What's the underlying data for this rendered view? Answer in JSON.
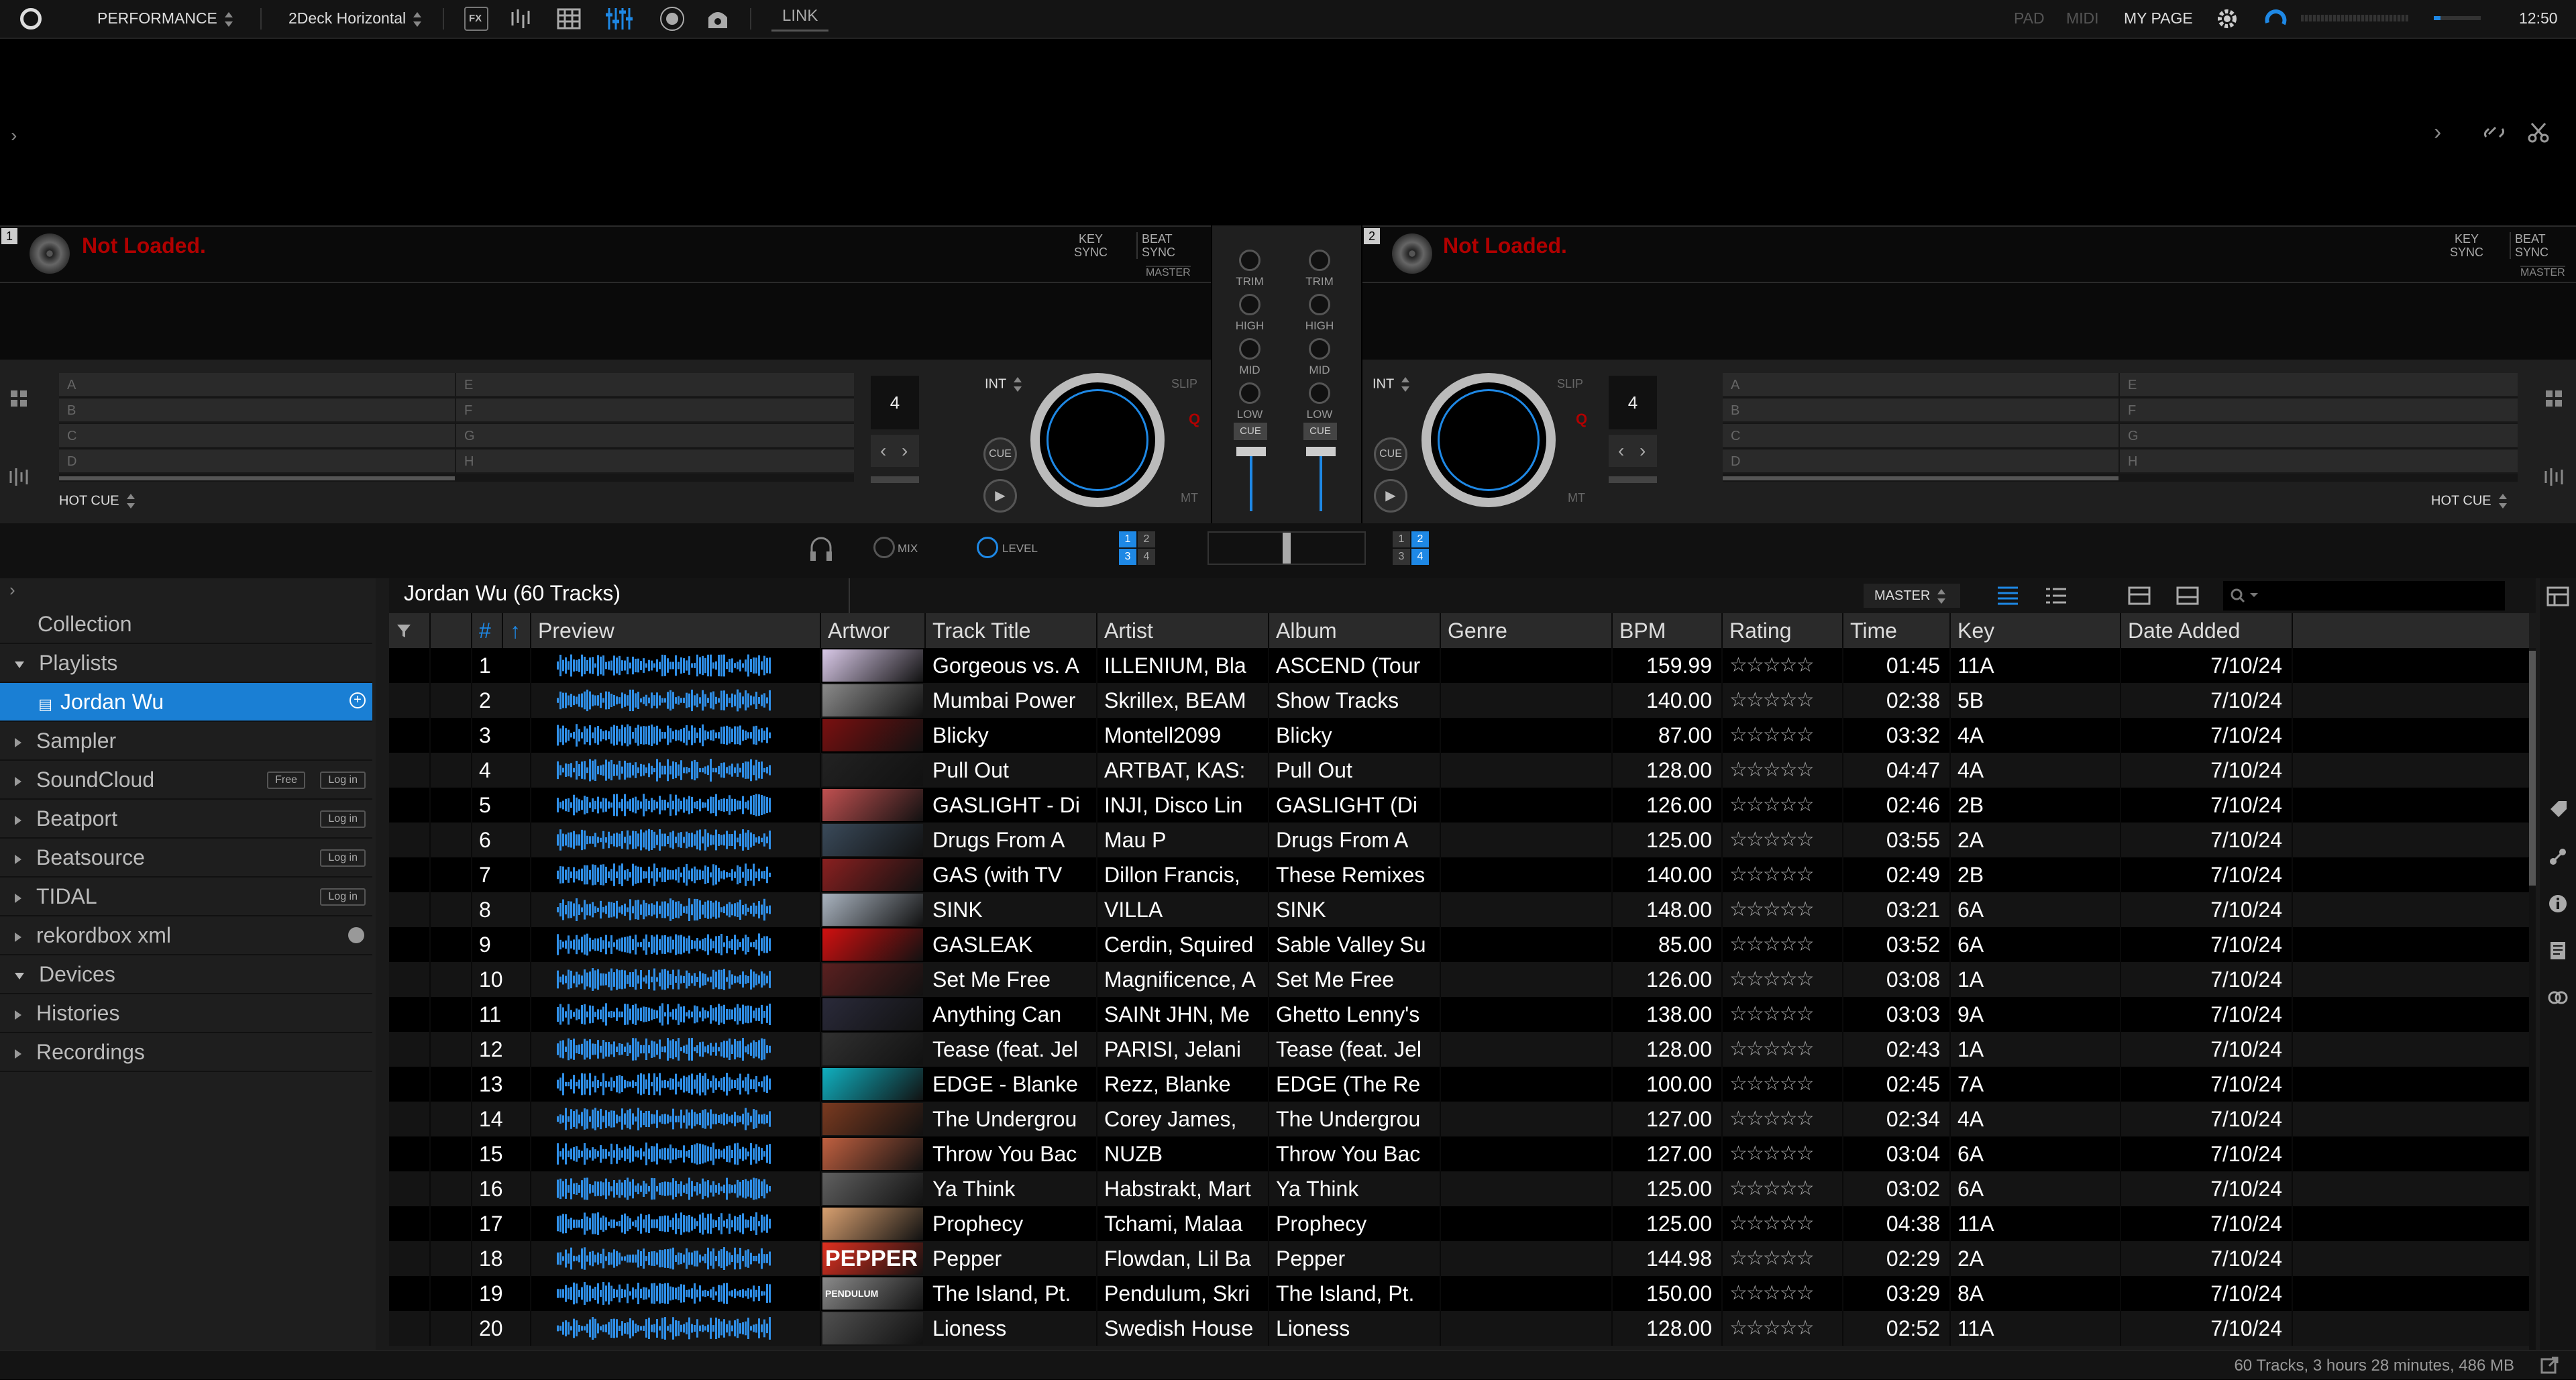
{
  "topbar": {
    "mode": "PERFORMANCE",
    "layout": "2Deck Horizontal",
    "fx": "FX",
    "link": "LINK",
    "pad": "PAD",
    "midi": "MIDI",
    "mypage": "MY PAGE",
    "time": "12:50"
  },
  "decks": [
    {
      "number": "1",
      "status": "Not Loaded.",
      "key_sync": [
        "KEY",
        "SYNC"
      ],
      "beat_sync": [
        "BEAT",
        "SYNC"
      ],
      "master": "MASTER",
      "hotcues": [
        "A",
        "B",
        "C",
        "D",
        "E",
        "F",
        "G",
        "H"
      ],
      "hotcue_label": "HOT CUE",
      "beat_count": "4",
      "int": "INT",
      "slip": "SLIP",
      "q": "Q",
      "mt": "MT",
      "cue": "CUE"
    },
    {
      "number": "2",
      "status": "Not Loaded.",
      "key_sync": [
        "KEY",
        "SYNC"
      ],
      "beat_sync": [
        "BEAT",
        "SYNC"
      ],
      "master": "MASTER",
      "hotcues": [
        "A",
        "B",
        "C",
        "D",
        "E",
        "F",
        "G",
        "H"
      ],
      "hotcue_label": "HOT CUE",
      "beat_count": "4",
      "int": "INT",
      "slip": "SLIP",
      "q": "Q",
      "mt": "MT",
      "cue": "CUE"
    }
  ],
  "mixer": {
    "labels": [
      "TRIM",
      "HIGH",
      "MID",
      "LOW"
    ],
    "cue": "CUE",
    "mix": "MIX",
    "level": "LEVEL",
    "fx_assign_left": [
      "1",
      "2",
      "3",
      "4"
    ],
    "fx_assign_right": [
      "1",
      "2",
      "3",
      "4"
    ]
  },
  "sidebar": {
    "items": [
      {
        "label": "Collection",
        "arrow": "none"
      },
      {
        "label": "Playlists",
        "arrow": "open"
      },
      {
        "label": "Jordan Wu",
        "arrow": "playlist",
        "selected": true
      },
      {
        "label": "Sampler",
        "arrow": "closed"
      },
      {
        "label": "SoundCloud",
        "arrow": "closed",
        "badges": [
          "Free",
          "Log in"
        ]
      },
      {
        "label": "Beatport",
        "arrow": "closed",
        "badges": [
          "Log in"
        ]
      },
      {
        "label": "Beatsource",
        "arrow": "closed",
        "badges": [
          "Log in"
        ]
      },
      {
        "label": "TIDAL",
        "arrow": "closed",
        "badges": [
          "Log in"
        ]
      },
      {
        "label": "rekordbox xml",
        "arrow": "closed"
      },
      {
        "label": "Devices",
        "arrow": "open"
      },
      {
        "label": "Histories",
        "arrow": "closed"
      },
      {
        "label": "Recordings",
        "arrow": "closed"
      }
    ]
  },
  "browser": {
    "title": "Jordan Wu (60 Tracks)",
    "master_label": "MASTER",
    "columns": [
      "#",
      "Preview",
      "Artwor",
      "Track Title",
      "Artist",
      "Album",
      "Genre",
      "BPM",
      "Rating",
      "Time",
      "Key",
      "Date Added"
    ],
    "rows": [
      {
        "n": "1",
        "title": "Gorgeous vs. A",
        "artist": "ILLENIUM, Bla",
        "album": "ASCEND (Tour",
        "bpm": "159.99",
        "time": "01:45",
        "key": "11A",
        "date": "7/10/24",
        "art": "#d9c9e8"
      },
      {
        "n": "2",
        "title": "Mumbai Power",
        "artist": "Skrillex, BEAM",
        "album": "Show Tracks",
        "bpm": "140.00",
        "time": "02:38",
        "key": "5B",
        "date": "7/10/24",
        "art": "#8a8a8a"
      },
      {
        "n": "3",
        "title": "Blicky",
        "artist": "Montell2099",
        "album": "Blicky",
        "bpm": "87.00",
        "time": "03:32",
        "key": "4A",
        "date": "7/10/24",
        "art": "#7a1010"
      },
      {
        "n": "4",
        "title": "Pull Out",
        "artist": "ARTBAT, KAS:",
        "album": "Pull Out",
        "bpm": "128.00",
        "time": "04:47",
        "key": "4A",
        "date": "7/10/24",
        "art": "#222"
      },
      {
        "n": "5",
        "title": "GASLIGHT - Di",
        "artist": "INJI, Disco Lin",
        "album": "GASLIGHT (Di",
        "bpm": "126.00",
        "time": "02:46",
        "key": "2B",
        "date": "7/10/24",
        "art": "#c05050"
      },
      {
        "n": "6",
        "title": "Drugs From A",
        "artist": "Mau P",
        "album": "Drugs From A",
        "bpm": "125.00",
        "time": "03:55",
        "key": "2A",
        "date": "7/10/24",
        "art": "#3a4a5a"
      },
      {
        "n": "7",
        "title": "GAS (with TV",
        "artist": "Dillon Francis,",
        "album": "These Remixes",
        "bpm": "140.00",
        "time": "02:49",
        "key": "2B",
        "date": "7/10/24",
        "art": "#8a2020"
      },
      {
        "n": "8",
        "title": "SINK",
        "artist": "VILLA",
        "album": "SINK",
        "bpm": "148.00",
        "time": "03:21",
        "key": "6A",
        "date": "7/10/24",
        "art": "#aab4c0"
      },
      {
        "n": "9",
        "title": "GASLEAK",
        "artist": "Cerdin, Squired",
        "album": "Sable Valley Su",
        "bpm": "85.00",
        "time": "03:52",
        "key": "6A",
        "date": "7/10/24",
        "art": "#d01010"
      },
      {
        "n": "10",
        "title": "Set Me Free",
        "artist": "Magnificence, A",
        "album": "Set Me Free",
        "bpm": "126.00",
        "time": "03:08",
        "key": "1A",
        "date": "7/10/24",
        "art": "#5a2020"
      },
      {
        "n": "11",
        "title": "Anything Can",
        "artist": "SAINt JHN, Me",
        "album": "Ghetto Lenny's",
        "bpm": "138.00",
        "time": "03:03",
        "key": "9A",
        "date": "7/10/24",
        "art": "#2a2a3a"
      },
      {
        "n": "12",
        "title": "Tease (feat. Jel",
        "artist": "PARISI, Jelani",
        "album": "Tease (feat. Jel",
        "bpm": "128.00",
        "time": "02:43",
        "key": "1A",
        "date": "7/10/24",
        "art": "#303030"
      },
      {
        "n": "13",
        "title": "EDGE - Blanke",
        "artist": "Rezz, Blanke",
        "album": "EDGE (The Re",
        "bpm": "100.00",
        "time": "02:45",
        "key": "7A",
        "date": "7/10/24",
        "art": "#10b0c0"
      },
      {
        "n": "14",
        "title": "The Undergrou",
        "artist": "Corey James,",
        "album": "The Undergrou",
        "bpm": "127.00",
        "time": "02:34",
        "key": "4A",
        "date": "7/10/24",
        "art": "#7a3a20"
      },
      {
        "n": "15",
        "title": "Throw You Bac",
        "artist": "NUZB",
        "album": "Throw You Bac",
        "bpm": "127.00",
        "time": "03:04",
        "key": "6A",
        "date": "7/10/24",
        "art": "#c06040"
      },
      {
        "n": "16",
        "title": "Ya Think",
        "artist": "Habstrakt, Mart",
        "album": "Ya Think",
        "bpm": "125.00",
        "time": "03:02",
        "key": "6A",
        "date": "7/10/24",
        "art": "#606060"
      },
      {
        "n": "17",
        "title": "Prophecy",
        "artist": "Tchami, Malaa",
        "album": "Prophecy",
        "bpm": "125.00",
        "time": "04:38",
        "key": "11A",
        "date": "7/10/24",
        "art": "#d8a070"
      },
      {
        "n": "18",
        "title": "Pepper",
        "artist": "Flowdan, Lil Ba",
        "album": "Pepper",
        "bpm": "144.98",
        "time": "02:29",
        "key": "2A",
        "date": "7/10/24",
        "art": "#e03020",
        "art_text": "PEPPER"
      },
      {
        "n": "19",
        "title": "The Island, Pt.",
        "artist": "Pendulum, Skri",
        "album": "The Island, Pt.",
        "bpm": "150.00",
        "time": "03:29",
        "key": "8A",
        "date": "7/10/24",
        "art": "#8a8a8a",
        "art_text": "PENDULUM"
      },
      {
        "n": "20",
        "title": "Lioness",
        "artist": "Swedish House",
        "album": "Lioness",
        "bpm": "128.00",
        "time": "02:52",
        "key": "11A",
        "date": "7/10/24",
        "art": "#505050"
      }
    ],
    "rating_stars": "☆☆☆☆☆"
  },
  "status": "60 Tracks, 3 hours 28 minutes, 486 MB",
  "colors": {
    "accent": "#1e88e5",
    "selected_row": "#1a7fd4",
    "alert": "#b00000"
  }
}
